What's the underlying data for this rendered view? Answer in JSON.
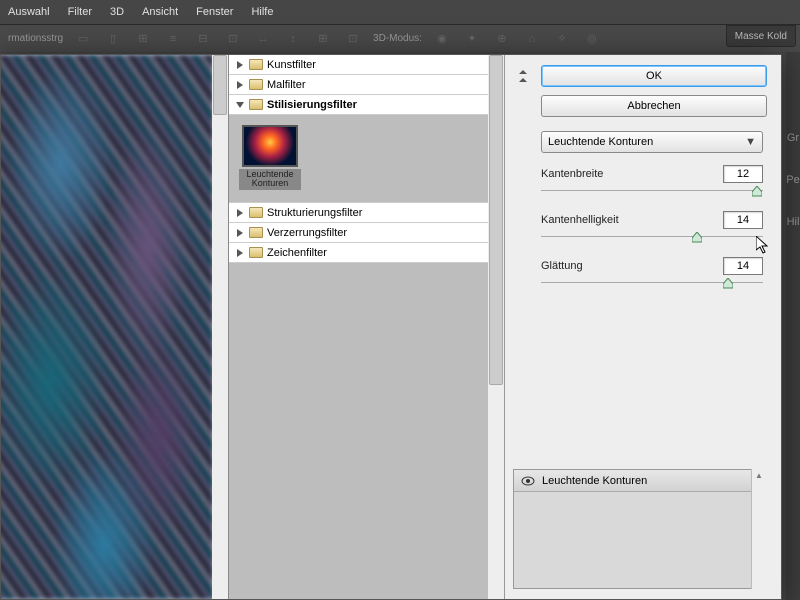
{
  "menu": {
    "items": [
      "Auswahl",
      "Filter",
      "3D",
      "Ansicht",
      "Fenster",
      "Hilfe"
    ]
  },
  "toolbar": {
    "left_label": "rmationsstrg",
    "mode_label": "3D-Modus:",
    "tag": "Masse Kold"
  },
  "tree": {
    "items": [
      {
        "label": "Kunstfilter",
        "expanded": false
      },
      {
        "label": "Malfilter",
        "expanded": false
      },
      {
        "label": "Stilisierungsfilter",
        "expanded": true,
        "selected": true
      },
      {
        "label": "Strukturierungsfilter",
        "expanded": false
      },
      {
        "label": "Verzerrungsfilter",
        "expanded": false
      },
      {
        "label": "Zeichenfilter",
        "expanded": false
      }
    ],
    "thumb_label": "Leuchtende Konturen"
  },
  "controls": {
    "ok": "OK",
    "cancel": "Abbrechen",
    "dropdown": "Leuchtende Konturen",
    "params": [
      {
        "label": "Kantenbreite",
        "value": "12",
        "pos": 95
      },
      {
        "label": "Kantenhelligkeit",
        "value": "14",
        "pos": 68
      },
      {
        "label": "Glättung",
        "value": "14",
        "pos": 82
      }
    ]
  },
  "fx": {
    "title": "Leuchtende Konturen"
  },
  "side_labels": [
    "Gr",
    "Pe",
    "Hil"
  ]
}
